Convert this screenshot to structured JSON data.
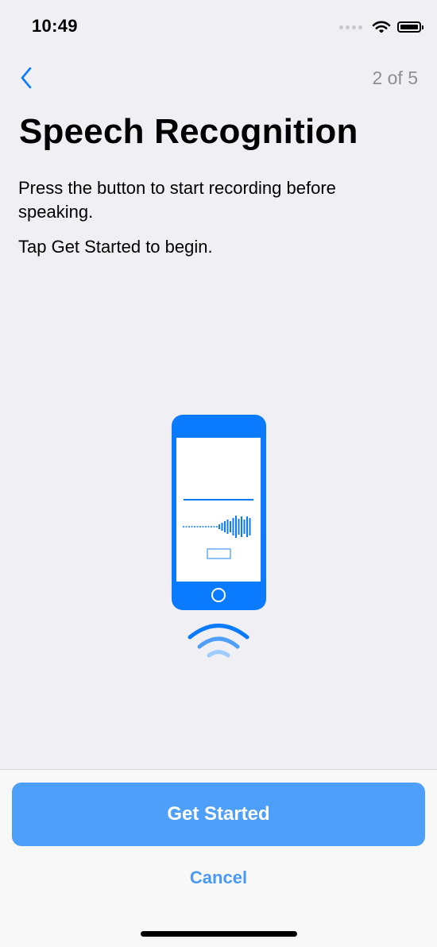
{
  "status_bar": {
    "time": "10:49",
    "icons": [
      "signal-dots-icon",
      "wifi-icon",
      "battery-icon"
    ]
  },
  "nav": {
    "back_icon": "chevron-left-icon",
    "step_counter": "2 of 5"
  },
  "content": {
    "title": "Speech Recognition",
    "description": "Press the button to start recording before speaking.",
    "instruction": "Tap Get Started to begin."
  },
  "illustration": {
    "icon": "phone-speech-illustration",
    "accent_color": "#0a7aff",
    "light_color": "#8ec3ff"
  },
  "footer": {
    "primary_button": "Get Started",
    "secondary_button": "Cancel",
    "primary_color": "#4d9ffa",
    "link_color": "#4a9af5"
  }
}
